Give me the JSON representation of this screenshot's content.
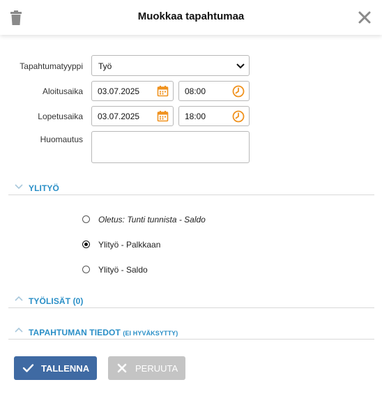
{
  "header": {
    "title": "Muokkaa tapahtumaa"
  },
  "form": {
    "type_label": "Tapahtumatyyppi",
    "type_value": "Työ",
    "start_label": "Aloitusaika",
    "start_date": "03.07.2025",
    "start_time": "08:00",
    "end_label": "Lopetusaika",
    "end_date": "03.07.2025",
    "end_time": "18:00",
    "note_label": "Huomautus",
    "note_value": ""
  },
  "sections": {
    "overtime": "YLITYÖ",
    "allowances": "TYÖLISÄT (0)",
    "details": "TAPAHTUMAN TIEDOT",
    "details_status": "(EI HYVÄKSYTTY)"
  },
  "overtime_options": [
    {
      "label": "Oletus: Tunti tunnista - Saldo",
      "selected": false
    },
    {
      "label": "Ylityö - Palkkaan",
      "selected": true
    },
    {
      "label": "Ylityö - Saldo",
      "selected": false
    }
  ],
  "buttons": {
    "save": "TALLENNA",
    "cancel": "PERUUTA"
  },
  "colors": {
    "accent": "#2a8fc7",
    "save_bg": "#3f6aa3",
    "cancel_bg": "#c4c4c4",
    "icon_orange": "#f0921e"
  },
  "icons": [
    "trash-icon",
    "close-icon",
    "chevron-down-icon",
    "calendar-icon",
    "clock-icon",
    "chevron-up-icon",
    "check-icon",
    "x-icon"
  ]
}
